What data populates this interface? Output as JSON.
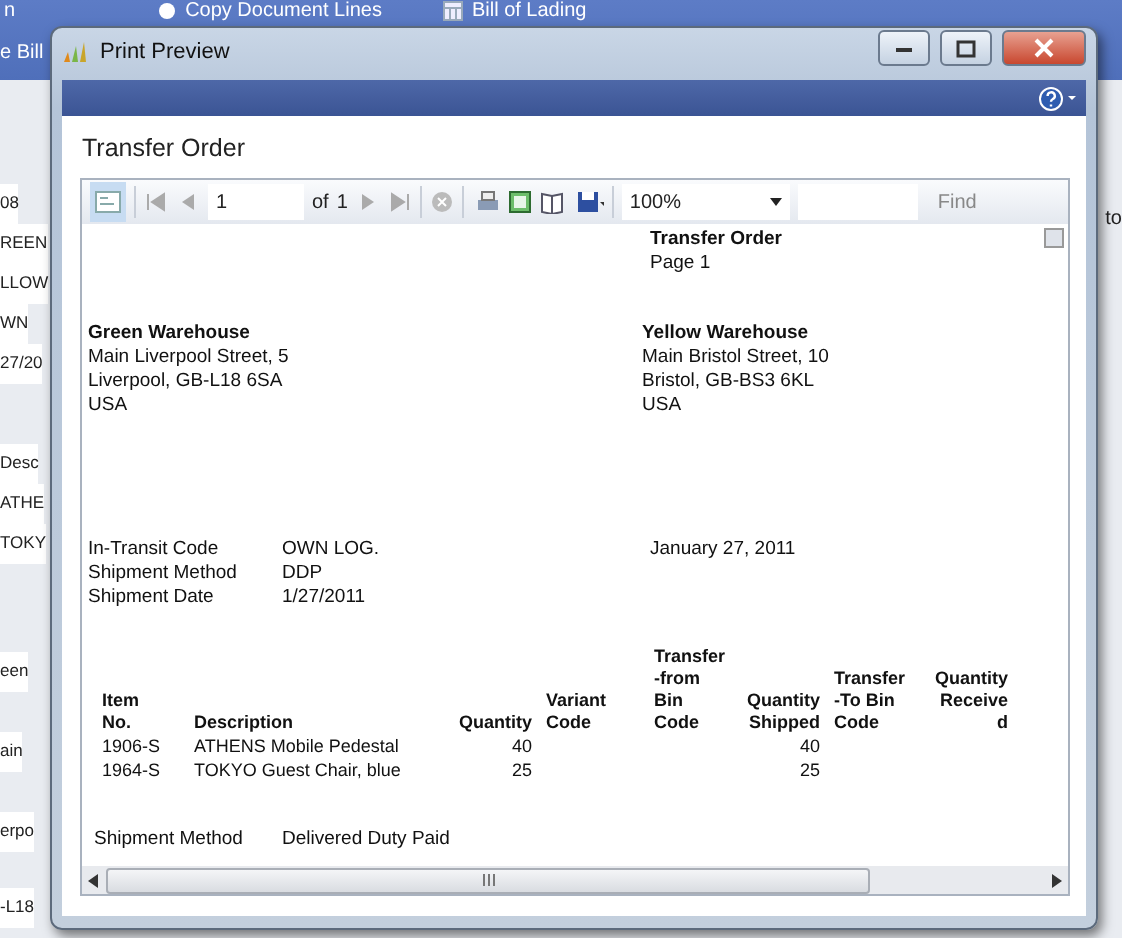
{
  "background": {
    "ribbon": [
      {
        "label": "n",
        "icon": false
      },
      {
        "label": "Copy Document Lines",
        "icon": true
      },
      {
        "label": "Bill of Lading",
        "icon": true
      },
      {
        "label": "e Bill",
        "icon": false
      }
    ],
    "side_fields": [
      "08",
      "REEN",
      "LLOW",
      "WN",
      "27/20",
      "Desc",
      "ATHE",
      "TOKY",
      "een",
      "ain",
      "erpo",
      "-L18"
    ],
    "right_fragment": "to"
  },
  "window": {
    "title": "Print Preview",
    "page_title": "Transfer Order"
  },
  "toolbar": {
    "page": "1",
    "of_label": "of",
    "page_count": "1",
    "zoom": "100%",
    "find": "Find"
  },
  "report": {
    "title": "Transfer Order",
    "page": "Page 1",
    "from_address": {
      "name": "Green Warehouse",
      "lines": [
        "Main Liverpool Street, 5",
        "Liverpool, GB-L18 6SA",
        "USA"
      ]
    },
    "to_address": {
      "name": "Yellow Warehouse",
      "lines": [
        "Main Bristol Street, 10",
        "Bristol, GB-BS3 6KL",
        "USA"
      ]
    },
    "info": [
      {
        "label": "In-Transit Code",
        "value": "OWN LOG."
      },
      {
        "label": "Shipment Method",
        "value": "DDP"
      },
      {
        "label": "Shipment Date",
        "value": "1/27/2011"
      }
    ],
    "date": "January 27, 2011",
    "columns": [
      {
        "lines": [
          "Item",
          "No."
        ],
        "kind": "text"
      },
      {
        "lines": [
          "Description"
        ],
        "kind": "text"
      },
      {
        "lines": [
          "Quantity"
        ],
        "kind": "number"
      },
      {
        "lines": [
          "Variant",
          "Code"
        ],
        "kind": "text"
      },
      {
        "lines": [
          "Transfer",
          "-from",
          "Bin",
          "Code"
        ],
        "kind": "text"
      },
      {
        "lines": [
          "Quantity",
          "Shipped"
        ],
        "kind": "number"
      },
      {
        "lines": [
          "Transfer",
          "-To Bin",
          "Code"
        ],
        "kind": "text"
      },
      {
        "lines": [
          "Quantity",
          "Receive",
          "d"
        ],
        "kind": "number"
      }
    ],
    "rows": [
      [
        "1906-S",
        "ATHENS Mobile Pedestal",
        "40",
        "",
        "",
        "40",
        "",
        ""
      ],
      [
        "1964-S",
        "TOKYO Guest Chair, blue",
        "25",
        "",
        "",
        "25",
        "",
        ""
      ]
    ],
    "footer": {
      "label": "Shipment Method",
      "value": "Delivered Duty Paid"
    }
  }
}
